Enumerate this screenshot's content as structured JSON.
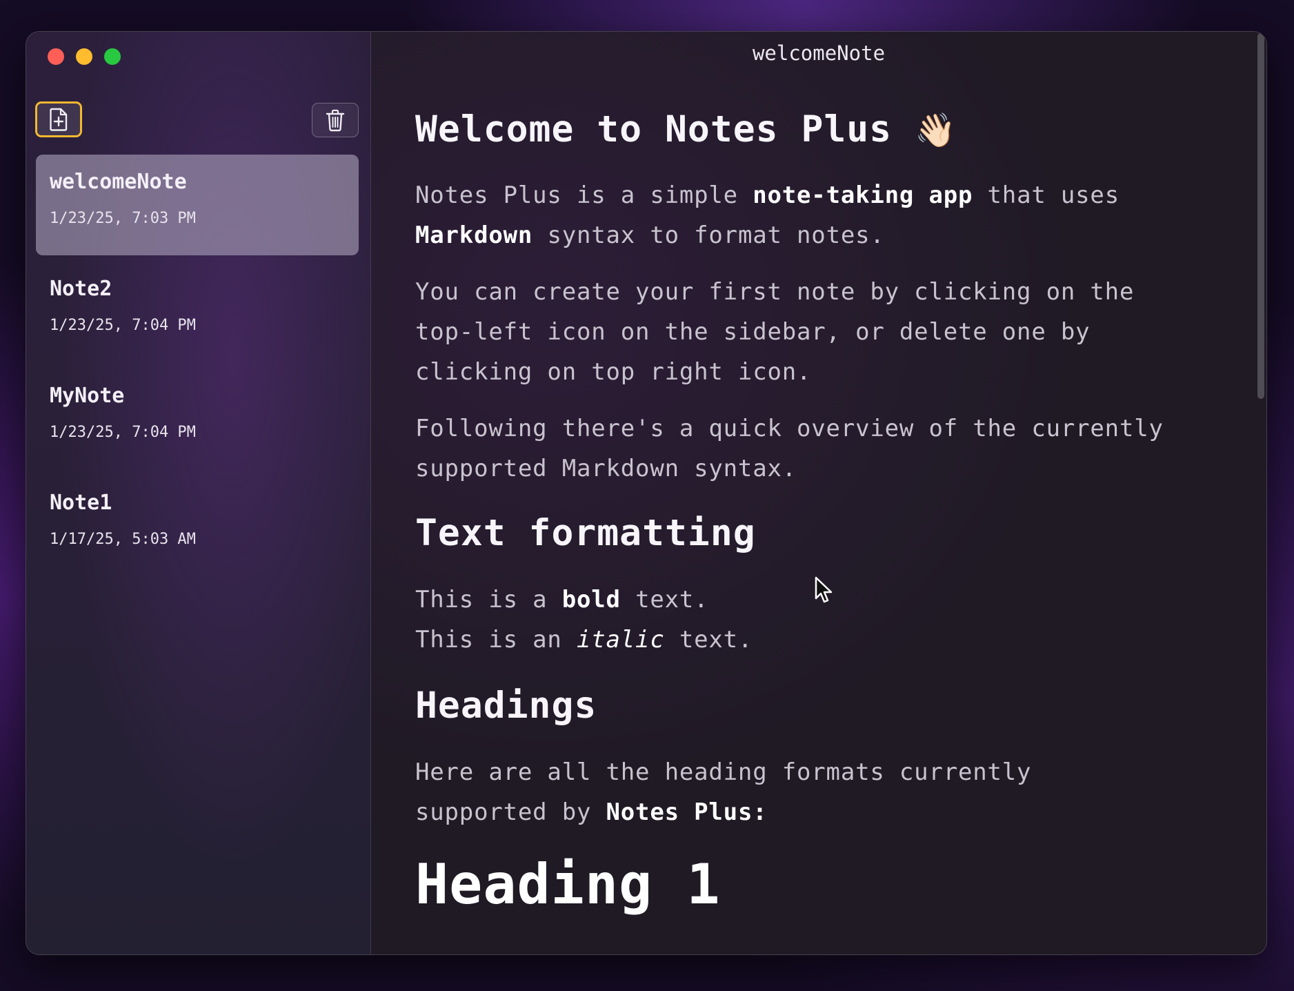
{
  "window": {
    "title": "welcomeNote"
  },
  "sidebar": {
    "new_note_icon": "doc-plus-icon",
    "delete_icon": "trash-icon",
    "notes": [
      {
        "title": "welcomeNote",
        "date": "1/23/25, 7:03 PM",
        "selected": true
      },
      {
        "title": "Note2",
        "date": "1/23/25, 7:04 PM",
        "selected": false
      },
      {
        "title": "MyNote",
        "date": "1/23/25, 7:04 PM",
        "selected": false
      },
      {
        "title": "Note1",
        "date": "1/17/25, 5:03 AM",
        "selected": false
      }
    ]
  },
  "content": {
    "heading_welcome": "Welcome to Notes Plus",
    "heading_welcome_emoji": "👋🏻",
    "intro": {
      "t1": "Notes Plus is a simple ",
      "b1": "note-taking app",
      "t2": " that uses ",
      "b2": "Markdown",
      "t3": " syntax to format notes."
    },
    "create_para": "You can create your first note by clicking on the top-left icon on the sidebar, or delete one by clicking on top right icon.",
    "overview_para": "Following there's a quick overview of the currently supported Markdown syntax.",
    "heading_text_formatting": "Text formatting",
    "bold_line": {
      "t1": "This is a ",
      "b": "bold",
      "t2": " text."
    },
    "italic_line": {
      "t1": "This is an ",
      "i": "italic",
      "t2": " text."
    },
    "heading_headings": "Headings",
    "headings_para": {
      "t1": "Here are all the heading formats currently supported by ",
      "b": "Notes Plus:"
    },
    "heading_1_example": "Heading 1"
  },
  "colors": {
    "accent_focus": "#f2b92f",
    "traffic_close": "#ff5f57",
    "traffic_minimize": "#febc2e",
    "traffic_maximize": "#28c840"
  }
}
